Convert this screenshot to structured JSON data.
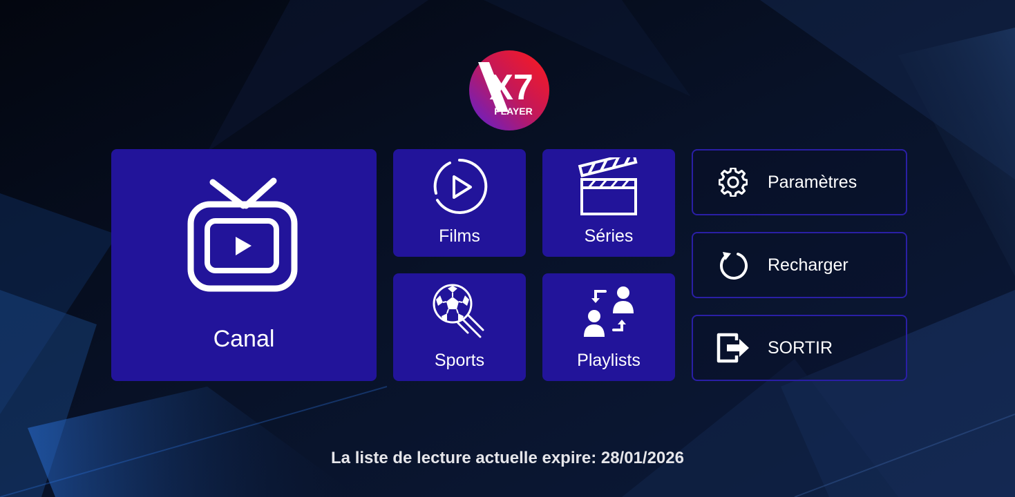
{
  "app": {
    "logo_text": "X7",
    "logo_subtext": "PLAYER"
  },
  "tiles": {
    "canal": {
      "label": "Canal",
      "icon": "tv-play-icon"
    },
    "films": {
      "label": "Films",
      "icon": "play-circle-icon"
    },
    "series": {
      "label": "Séries",
      "icon": "clapperboard-icon"
    },
    "sports": {
      "label": "Sports",
      "icon": "soccer-ball-icon"
    },
    "playlists": {
      "label": "Playlists",
      "icon": "users-swap-icon"
    }
  },
  "side_menu": [
    {
      "label": "Paramètres",
      "icon": "gear-icon"
    },
    {
      "label": "Recharger",
      "icon": "reload-icon"
    },
    {
      "label": "SORTIR",
      "icon": "exit-icon"
    }
  ],
  "footer": {
    "expiry_text": "La liste de lecture actuelle expire: 28/01/2026"
  },
  "colors": {
    "tile_bg": "#22149a",
    "side_border": "#2a1fa6",
    "background": "#050a18",
    "logo_gradient": [
      "#ff1a1a",
      "#c2185b",
      "#5b21d6"
    ]
  }
}
